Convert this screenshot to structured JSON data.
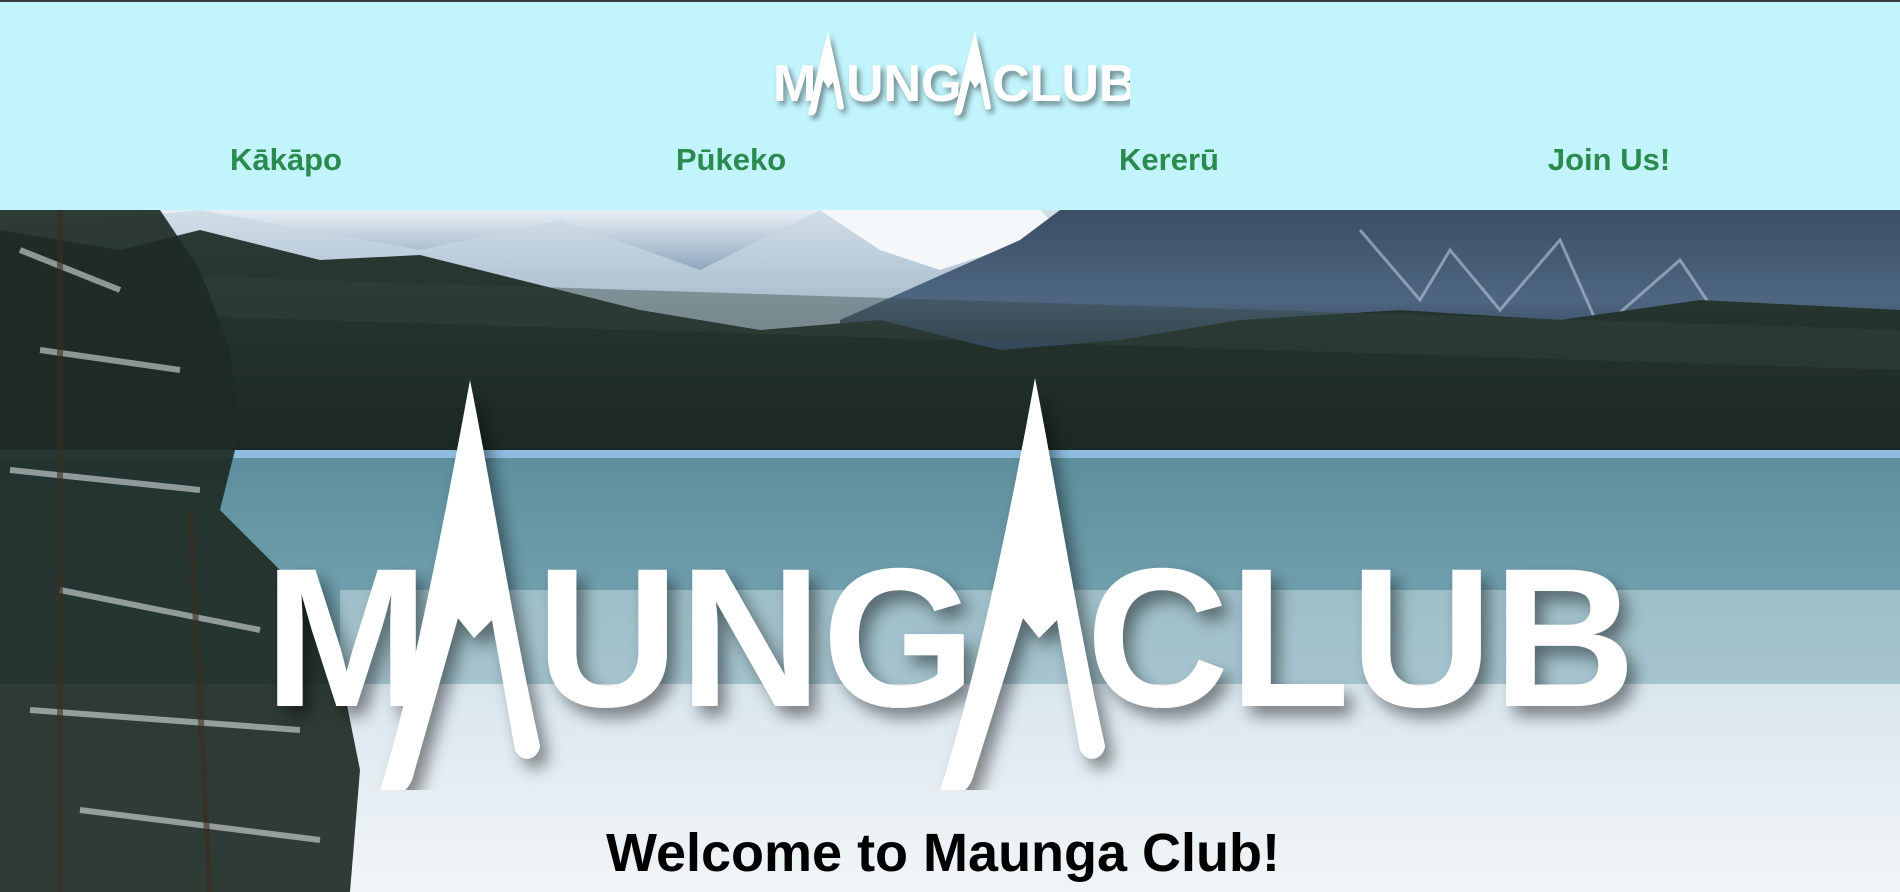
{
  "header": {
    "logo_text_left": "M",
    "logo_text_mid": "UNG",
    "logo_text_right": "CLUB",
    "background": "#c2f4fc"
  },
  "nav": {
    "items": [
      {
        "label": "Kākāpo"
      },
      {
        "label": "Pūkeko"
      },
      {
        "label": "Kererū"
      },
      {
        "label": "Join Us!"
      }
    ],
    "link_color": "#2b8a4e"
  },
  "hero": {
    "logo_text_left": "M",
    "logo_text_mid": "UNG",
    "logo_text_right": "CLUB",
    "heading": "Welcome to Maunga Club!"
  }
}
